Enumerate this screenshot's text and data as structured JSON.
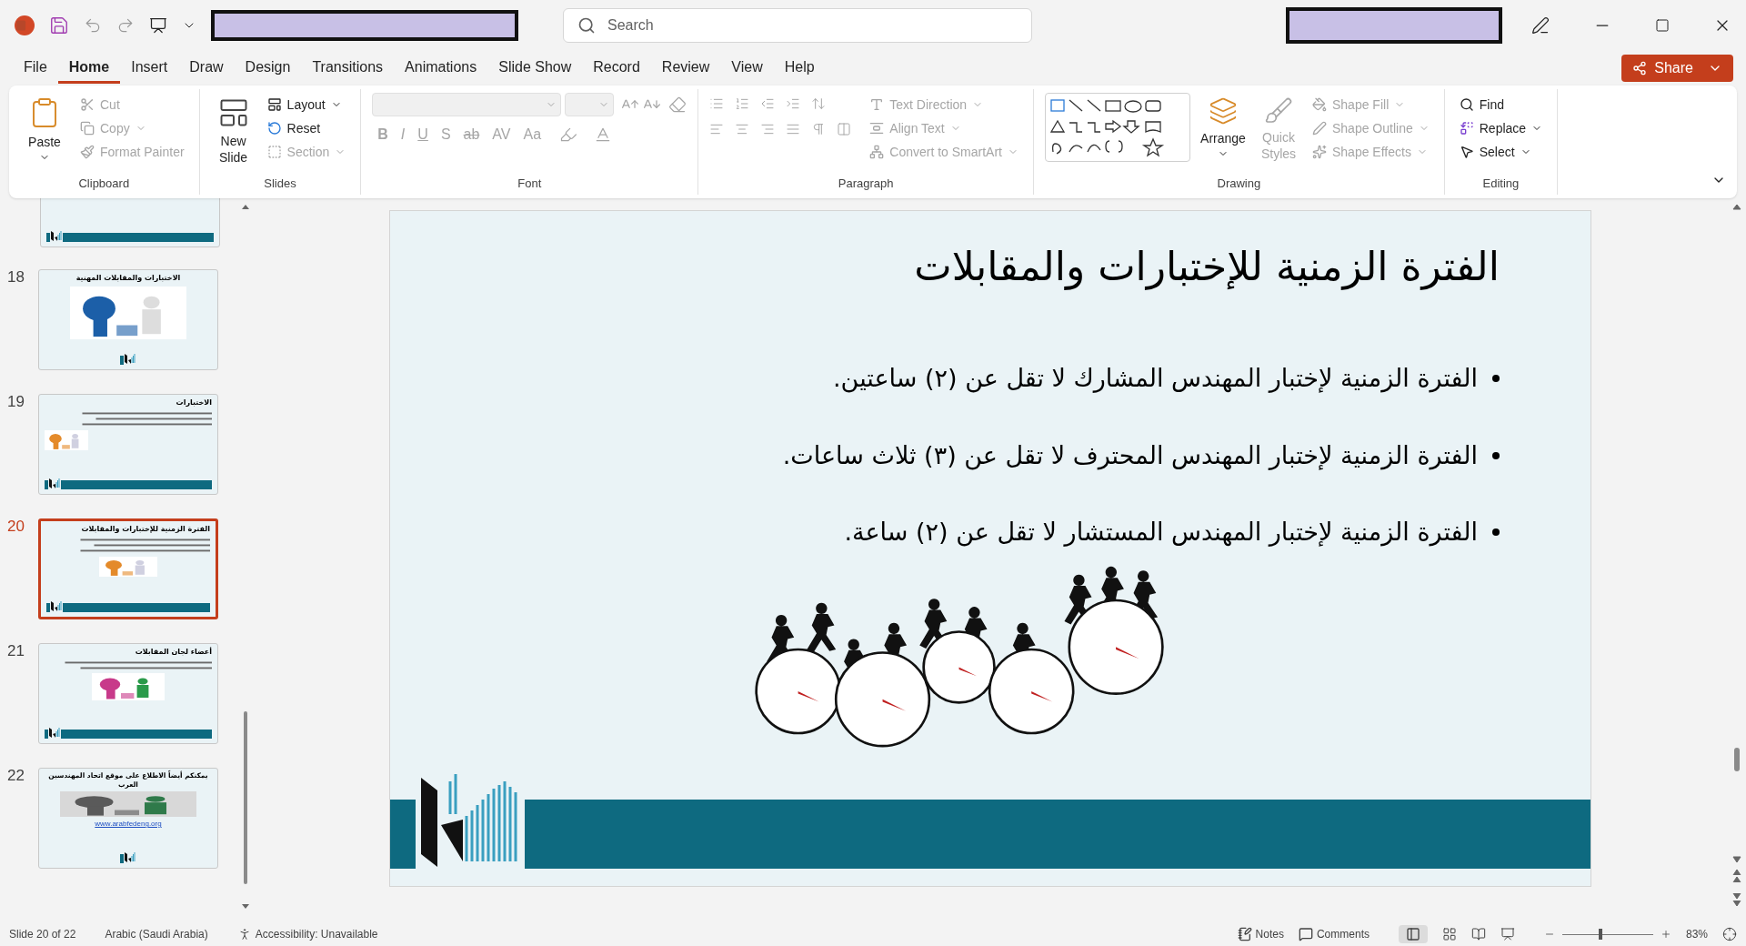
{
  "title_bar": {
    "search": {
      "placeholder": "Search"
    }
  },
  "menu_tabs": [
    {
      "label": "File",
      "selected": false
    },
    {
      "label": "Home",
      "selected": true
    },
    {
      "label": "Insert",
      "selected": false
    },
    {
      "label": "Draw",
      "selected": false
    },
    {
      "label": "Design",
      "selected": false
    },
    {
      "label": "Transitions",
      "selected": false
    },
    {
      "label": "Animations",
      "selected": false
    },
    {
      "label": "Slide Show",
      "selected": false
    },
    {
      "label": "Record",
      "selected": false
    },
    {
      "label": "Review",
      "selected": false
    },
    {
      "label": "View",
      "selected": false
    },
    {
      "label": "Help",
      "selected": false
    }
  ],
  "share_button": {
    "label": "Share"
  },
  "ribbon": {
    "groups": [
      {
        "kind": "clipboard",
        "label": "Clipboard",
        "items": [
          {
            "label": "Paste",
            "disabled": false
          },
          {
            "label": "Cut",
            "disabled": true
          },
          {
            "label": "Copy",
            "disabled": true
          },
          {
            "label": "Format Painter",
            "disabled": true
          }
        ]
      },
      {
        "kind": "slides",
        "label": "Slides",
        "items": [
          {
            "label": "New Slide",
            "disabled": false
          },
          {
            "label": "Layout",
            "disabled": false
          },
          {
            "label": "Reset",
            "disabled": false
          },
          {
            "label": "Section",
            "disabled": true
          }
        ]
      },
      {
        "kind": "font",
        "label": "Font",
        "items": [
          {
            "label": "B",
            "disabled": true
          },
          {
            "label": "I",
            "disabled": true
          },
          {
            "label": "U",
            "disabled": true
          },
          {
            "label": "S",
            "disabled": true
          },
          {
            "label": "ab",
            "disabled": true
          },
          {
            "label": "AV",
            "disabled": true
          },
          {
            "label": "Aa",
            "disabled": true
          }
        ]
      },
      {
        "kind": "paragraph",
        "label": "Paragraph",
        "items": [
          {
            "label": "Text Direction",
            "disabled": true
          },
          {
            "label": "Align Text",
            "disabled": true
          },
          {
            "label": "Convert to SmartArt",
            "disabled": true
          }
        ]
      },
      {
        "kind": "drawing",
        "label": "Drawing",
        "items": [
          {
            "label": "Arrange",
            "disabled": false
          },
          {
            "label": "Quick Styles",
            "disabled": true
          },
          {
            "label": "Shape Fill",
            "disabled": true
          },
          {
            "label": "Shape Outline",
            "disabled": true
          },
          {
            "label": "Shape Effects",
            "disabled": true
          }
        ]
      },
      {
        "kind": "editing",
        "label": "Editing",
        "items": [
          {
            "label": "Find",
            "disabled": false
          },
          {
            "label": "Replace",
            "disabled": false
          },
          {
            "label": "Select",
            "disabled": false
          }
        ]
      }
    ]
  },
  "thumbnails": [
    {
      "kind": "table",
      "selected": false
    },
    {
      "kind": "picture",
      "number": "18",
      "selected": false,
      "title": "الاختبارات والمقابلات المهنية"
    },
    {
      "kind": "bullets",
      "number": "19",
      "selected": false,
      "title": "الاختبارات"
    },
    {
      "kind": "bullets",
      "number": "20",
      "selected": true,
      "title": "الفترة الزمنية للإختبارات والمقابلات"
    },
    {
      "kind": "paragraph",
      "number": "21",
      "selected": false,
      "title": "أعضاء لجان المقابلات"
    },
    {
      "kind": "link",
      "number": "22",
      "selected": false,
      "title": "يمكنكم أيضاً الاطلاع على موقع اتحاد المهندسين العرب",
      "link": "www.arabfedeng.org"
    }
  ],
  "slide": {
    "title": "الفترة الزمنية للإختبارات والمقابلات",
    "bullets": [
      "الفترة الزمنية لإختبار المهندس المشارك لا تقل عن (٢) ساعتين.",
      "الفترة الزمنية لإختبار المهندس المحترف لا تقل عن (٣) ثلاث ساعات.",
      "الفترة الزمنية لإختبار المهندس المستشار لا تقل عن (٢) ساعة."
    ]
  },
  "status_bar": {
    "slide_position": "Slide 20 of 22",
    "language": "Arabic (Saudi Arabia)",
    "accessibility": "Accessibility: Unavailable",
    "notes": "Notes",
    "comments": "Comments",
    "zoom": {
      "level": 0.42,
      "reading": "83%"
    }
  }
}
